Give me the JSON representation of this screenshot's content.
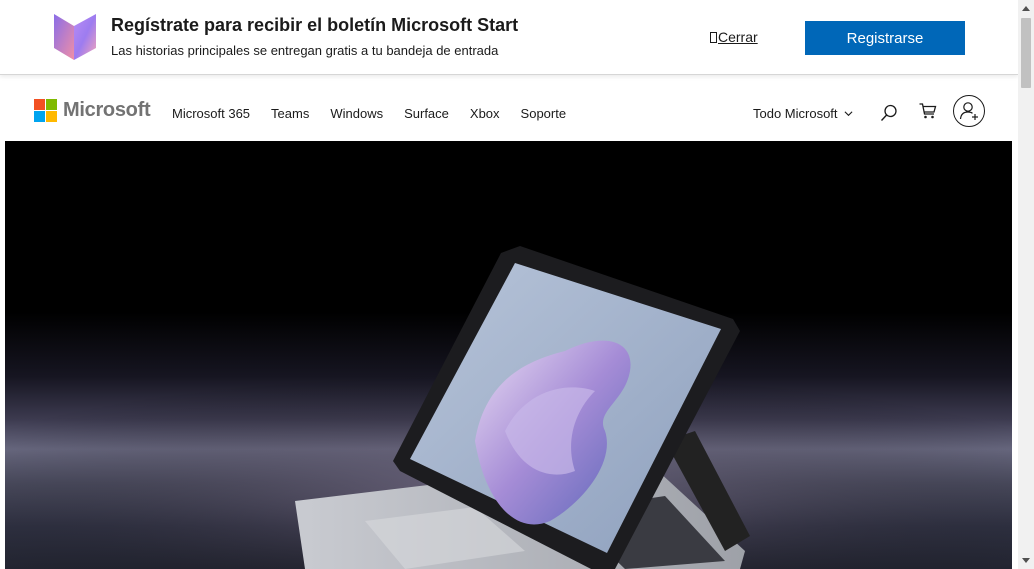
{
  "banner": {
    "title": "Regístrate para recibir el boletín Microsoft Start",
    "subtitle": "Las historias principales se entregan gratis a tu bandeja de entrada",
    "close_label": "Cerrar",
    "register_label": "Registrarse"
  },
  "header": {
    "brand": "Microsoft",
    "nav": [
      "Microsoft 365",
      "Teams",
      "Windows",
      "Surface",
      "Xbox",
      "Soporte"
    ],
    "all_microsoft": "Todo Microsoft",
    "icons": [
      "search-icon",
      "cart-icon",
      "account-icon"
    ]
  },
  "colors": {
    "accent": "#0067b8",
    "logo_red": "#f25022",
    "logo_green": "#7fba00",
    "logo_blue": "#00a4ef",
    "logo_yellow": "#ffb900"
  }
}
